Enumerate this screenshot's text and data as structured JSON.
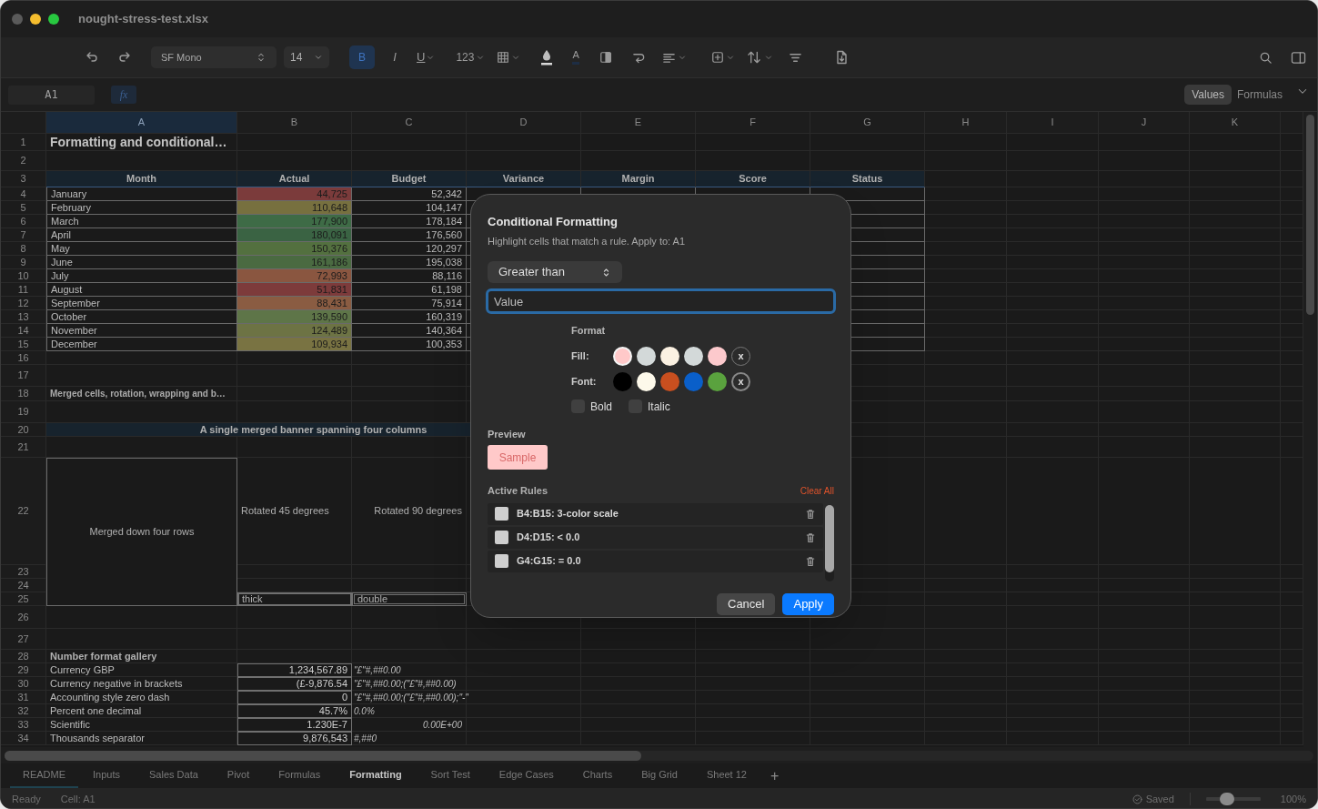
{
  "window": {
    "title": "nought-stress-test.xlsx"
  },
  "toolbar": {
    "font": "SF Mono",
    "font_size": "14",
    "styles": [
      {
        "label": "B",
        "selected": true
      },
      {
        "label": "I",
        "selected": false
      },
      {
        "label": "U",
        "selected": false
      }
    ],
    "number_format": "123",
    "font_color_label": "A"
  },
  "formula_bar": {
    "cell": "A1",
    "fx": "fx",
    "view_modes": [
      {
        "label": "Values",
        "selected": true
      },
      {
        "label": "Formulas",
        "selected": false
      }
    ]
  },
  "sheet": {
    "columns": [
      {
        "label": "A",
        "selected": true
      },
      {
        "label": "B",
        "selected": false
      },
      {
        "label": "C",
        "selected": false
      },
      {
        "label": "D",
        "selected": false
      },
      {
        "label": "E",
        "selected": false
      },
      {
        "label": "F",
        "selected": false
      },
      {
        "label": "G",
        "selected": false
      },
      {
        "label": "H",
        "selected": false
      },
      {
        "label": "I",
        "selected": false
      },
      {
        "label": "J",
        "selected": false
      },
      {
        "label": "K",
        "selected": false
      }
    ],
    "row_numbers": [
      "1",
      "2",
      "3",
      "4",
      "5",
      "6",
      "7",
      "8",
      "9",
      "10",
      "11",
      "12",
      "13",
      "14",
      "15",
      "16",
      "17",
      "18",
      "19",
      "20",
      "21",
      "22",
      "23",
      "24",
      "25",
      "26",
      "27",
      "28",
      "29",
      "30",
      "31",
      "32",
      "33",
      "34"
    ],
    "title": "Formatting and conditional…",
    "table": {
      "headers": [
        "Month",
        "Actual",
        "Budget",
        "Variance",
        "Margin",
        "Score",
        "Status"
      ],
      "rows": [
        {
          "month": "January",
          "actual": "44,725",
          "color": "#7b3b3b",
          "budget": "52,342"
        },
        {
          "month": "February",
          "actual": "110,648",
          "color": "#77703f",
          "budget": "104,147"
        },
        {
          "month": "March",
          "actual": "177,900",
          "color": "#3e6b46",
          "budget": "178,184"
        },
        {
          "month": "April",
          "actual": "180,091",
          "color": "#3a6343",
          "budget": "176,560"
        },
        {
          "month": "May",
          "actual": "150,376",
          "color": "#53703f",
          "budget": "120,297"
        },
        {
          "month": "June",
          "actual": "161,186",
          "color": "#4a6a41",
          "budget": "195,038"
        },
        {
          "month": "July",
          "actual": "72,993",
          "color": "#8a5640",
          "budget": "88,116"
        },
        {
          "month": "August",
          "actual": "51,831",
          "color": "#7d3b3b",
          "budget": "61,198"
        },
        {
          "month": "September",
          "actual": "88,431",
          "color": "#8a5c42",
          "budget": "75,914"
        },
        {
          "month": "October",
          "actual": "139,590",
          "color": "#5e7548",
          "budget": "160,319"
        },
        {
          "month": "November",
          "actual": "124,489",
          "color": "#6d7344",
          "budget": "140,364"
        },
        {
          "month": "December",
          "actual": "109,934",
          "color": "#797342",
          "budget": "100,353"
        }
      ]
    },
    "section_title": "Merged cells, rotation, wrapping and b…",
    "banner": "A single merged banner spanning four columns",
    "merged_cell": "Merged down four rows",
    "rotated": [
      "Rotated 45 degrees",
      "Rotated 90 degrees"
    ],
    "borders": [
      {
        "label": "thick",
        "kind": "thick"
      },
      {
        "label": "double",
        "kind": "double"
      }
    ],
    "gallery": {
      "title": "Number format gallery",
      "rows": [
        {
          "label": "Currency GBP",
          "value": "1,234,567.89",
          "format": "\"£\"#,##0.00",
          "kind": "left-aligned"
        },
        {
          "label": "Currency negative in brackets",
          "value": "(£-9,876.54",
          "format": "\"£\"#,##0.00;(\"£\"#,##0.00)",
          "kind": "left-aligned"
        },
        {
          "label": "Accounting style zero dash",
          "value": "0",
          "format": "\"£\"#,##0.00;(\"£\"#,##0.00);\"-\"",
          "kind": "left-aligned"
        },
        {
          "label": "Percent one decimal",
          "value": "45.7%",
          "format": "0.0%",
          "kind": "left-aligned"
        },
        {
          "label": "Scientific",
          "value": "1.230E-7",
          "format": "0.00E+00",
          "kind": "right-aligned"
        },
        {
          "label": "Thousands separator",
          "value": "9,876,543",
          "format": "#,##0",
          "kind": "left-aligned"
        }
      ]
    }
  },
  "sheet_tabs": [
    {
      "label": "README",
      "selected": false,
      "focused": true
    },
    {
      "label": "Inputs",
      "selected": false,
      "focused": false
    },
    {
      "label": "Sales Data",
      "selected": false,
      "focused": false
    },
    {
      "label": "Pivot",
      "selected": false,
      "focused": false
    },
    {
      "label": "Formulas",
      "selected": false,
      "focused": false
    },
    {
      "label": "Formatting",
      "selected": true,
      "focused": false
    },
    {
      "label": "Sort Test",
      "selected": false,
      "focused": false
    },
    {
      "label": "Edge Cases",
      "selected": false,
      "focused": false
    },
    {
      "label": "Charts",
      "selected": false,
      "focused": false
    },
    {
      "label": "Big Grid",
      "selected": false,
      "focused": false
    },
    {
      "label": "Sheet 12",
      "selected": false,
      "focused": false
    }
  ],
  "add_sheet": "+",
  "status_bar": {
    "state": "Ready",
    "cell": "Cell: A1",
    "saved": "Saved",
    "level": 0.35,
    "zoom": "100%"
  },
  "dialog": {
    "title": "Conditional Formatting",
    "subtitle": "Highlight cells that match a rule. Apply to: A1",
    "condition": "Greater than",
    "value_placeholder": "Value",
    "format_label": "Format",
    "fill_label": "Fill:",
    "fill_swatches": [
      {
        "color": "#ffc9c9",
        "selected": true
      },
      {
        "color": "#d3d9d9",
        "selected": false
      },
      {
        "color": "#fbf1e2",
        "selected": false
      },
      {
        "color": "#d3d9d9",
        "selected": false
      },
      {
        "color": "#fcc9cc",
        "selected": false
      }
    ],
    "fill_none": "x",
    "font_label": "Font:",
    "font_swatches": [
      {
        "color": "#000000",
        "selected": false
      },
      {
        "color": "#fdf9ea",
        "selected": false
      },
      {
        "color": "#c94f1f",
        "selected": false
      },
      {
        "color": "#0a5fc9",
        "selected": false
      },
      {
        "color": "#5aa23e",
        "selected": false
      }
    ],
    "font_none": "x",
    "options": [
      {
        "label": "Bold",
        "checked": false
      },
      {
        "label": "Italic",
        "checked": false
      }
    ],
    "preview_label": "Preview",
    "sample": "Sample",
    "rules_label": "Active Rules",
    "clear_all": "Clear All",
    "rules": [
      "B4:B15: 3-color scale",
      "D4:D15: < 0.0",
      "G4:G15: = 0.0"
    ],
    "buttons": [
      {
        "label": "Cancel",
        "kind": "secondary"
      },
      {
        "label": "Apply",
        "kind": "primary"
      }
    ]
  }
}
